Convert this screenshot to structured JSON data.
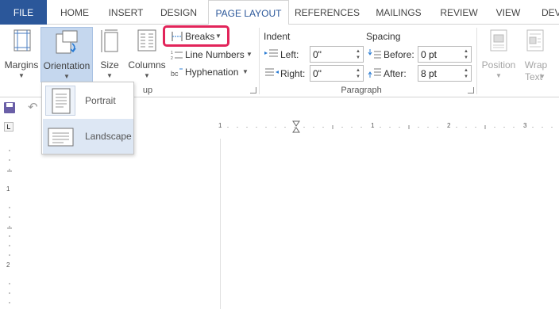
{
  "tabs": [
    {
      "label": "FILE"
    },
    {
      "label": "HOME"
    },
    {
      "label": "INSERT"
    },
    {
      "label": "DESIGN"
    },
    {
      "label": "PAGE LAYOUT",
      "active": true
    },
    {
      "label": "REFERENCES"
    },
    {
      "label": "MAILINGS"
    },
    {
      "label": "REVIEW"
    },
    {
      "label": "VIEW"
    },
    {
      "label": "DEV"
    }
  ],
  "page_setup": {
    "margins": "Margins",
    "orientation": "Orientation",
    "size": "Size",
    "columns": "Columns",
    "breaks": "Breaks",
    "line_numbers": "Line Numbers",
    "hyphenation": "Hyphenation",
    "group_label_partial": "up"
  },
  "paragraph": {
    "indent_header": "Indent",
    "spacing_header": "Spacing",
    "left_label": "Left:",
    "left_value": "0\"",
    "right_label": "Right:",
    "right_value": "0\"",
    "before_label": "Before:",
    "before_value": "0 pt",
    "after_label": "After:",
    "after_value": "8 pt",
    "group_label": "Paragraph"
  },
  "arrange": {
    "position": "Position",
    "wrap_line1": "Wrap",
    "wrap_line2": "Text"
  },
  "orientation_menu": {
    "portrait": "Portrait",
    "landscape": "Landscape"
  },
  "ruler": {
    "h_numbers": [
      "1",
      "1",
      "2",
      "3"
    ],
    "v_numbers": [
      "1",
      "2"
    ]
  },
  "colors": {
    "file_tab": "#2b579a",
    "accent": "#2b579a",
    "highlight": "#e2245a",
    "selected_button": "#c5d7ee"
  }
}
